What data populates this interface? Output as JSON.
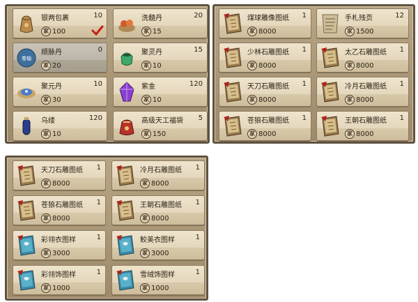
{
  "currency_glyph": "家",
  "top_left": [
    {
      "name": "银两包裹",
      "qty": "10",
      "price": "100",
      "icon": "sack-icon",
      "color": "#b98a4a",
      "selected": true
    },
    {
      "name": "洗髓丹",
      "qty": "20",
      "price": "15",
      "icon": "pill-bowl-icon",
      "color": "#d25a2a"
    },
    {
      "name": "顺脉丹",
      "qty": "0",
      "price": "20",
      "icon": "scroll-seal-icon",
      "color": "#3f6f9d",
      "badge": "卷轴",
      "disabled": true
    },
    {
      "name": "聚灵丹",
      "qty": "15",
      "price": "10",
      "icon": "jade-pot-icon",
      "color": "#3ea86a"
    },
    {
      "name": "聚元丹",
      "qty": "10",
      "price": "30",
      "icon": "gem-dish-icon",
      "color": "#4a7cc8"
    },
    {
      "name": "紫金",
      "qty": "120",
      "price": "10",
      "icon": "purple-crystal-icon",
      "color": "#8a3fd1"
    },
    {
      "name": "乌缕",
      "qty": "120",
      "price": "10",
      "icon": "blue-vial-icon",
      "color": "#2a3f8c"
    },
    {
      "name": "高级天工福袋",
      "qty": "5",
      "price": "150",
      "icon": "red-bag-icon",
      "color": "#b8322a"
    }
  ],
  "top_right": [
    {
      "name": "煤球雕像图纸",
      "qty": "1",
      "price": "8000",
      "icon": "blueprint-book-icon",
      "color": "#9a7a4c"
    },
    {
      "name": "手札残页",
      "qty": "12",
      "price": "1500",
      "icon": "torn-page-icon",
      "color": "#cdbd98"
    },
    {
      "name": "少林石雕图纸",
      "qty": "1",
      "price": "8000",
      "icon": "blueprint-book-icon",
      "color": "#9a7a4c"
    },
    {
      "name": "太乙石雕图纸",
      "qty": "1",
      "price": "8000",
      "icon": "blueprint-book-icon",
      "color": "#9a7a4c"
    },
    {
      "name": "天刀石雕图纸",
      "qty": "1",
      "price": "8000",
      "icon": "blueprint-book-icon",
      "color": "#9a7a4c"
    },
    {
      "name": "冷月石雕图纸",
      "qty": "1",
      "price": "8000",
      "icon": "blueprint-book-icon",
      "color": "#9a7a4c"
    },
    {
      "name": "苍狼石雕图纸",
      "qty": "1",
      "price": "8000",
      "icon": "blueprint-book-icon",
      "color": "#9a7a4c"
    },
    {
      "name": "王朝石雕图纸",
      "qty": "1",
      "price": "8000",
      "icon": "blueprint-book-icon",
      "color": "#9a7a4c"
    }
  ],
  "bottom": [
    {
      "name": "天刀石雕图纸",
      "qty": "1",
      "price": "8000",
      "icon": "blueprint-book-icon",
      "color": "#9a7a4c"
    },
    {
      "name": "冷月石雕图纸",
      "qty": "1",
      "price": "8000",
      "icon": "blueprint-book-icon",
      "color": "#9a7a4c"
    },
    {
      "name": "苍狼石雕图纸",
      "qty": "1",
      "price": "8000",
      "icon": "blueprint-book-icon",
      "color": "#9a7a4c"
    },
    {
      "name": "王朝石雕图纸",
      "qty": "1",
      "price": "8000",
      "icon": "blueprint-book-icon",
      "color": "#9a7a4c"
    },
    {
      "name": "彩翎衣图样",
      "qty": "1",
      "price": "3000",
      "icon": "cloth-pattern-book-icon",
      "color": "#3a88a8"
    },
    {
      "name": "鲛美衣图样",
      "qty": "1",
      "price": "3000",
      "icon": "cloth-pattern-book-icon",
      "color": "#3a88a8"
    },
    {
      "name": "彩翎饰图样",
      "qty": "1",
      "price": "1000",
      "icon": "cloth-pattern-book-icon",
      "color": "#3a88a8"
    },
    {
      "name": "雪绒饰图样",
      "qty": "1",
      "price": "1000",
      "icon": "cloth-pattern-book-icon",
      "color": "#3a88a8"
    }
  ]
}
